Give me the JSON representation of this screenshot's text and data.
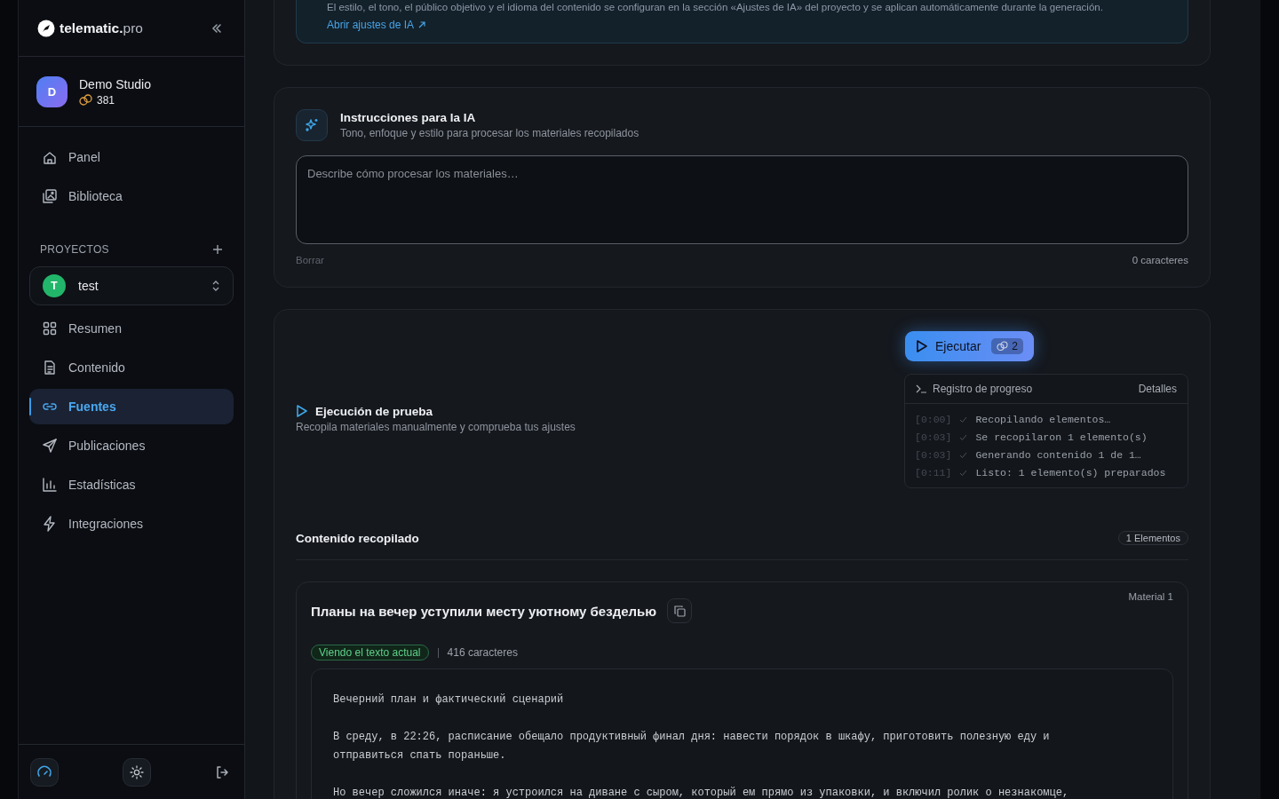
{
  "sidebar": {
    "brand": {
      "name": "telematic.",
      "suffix": "pro"
    },
    "account": {
      "initial": "D",
      "name": "Demo Studio",
      "credits": "381"
    },
    "nav": [
      {
        "label": "Panel",
        "selected": false
      },
      {
        "label": "Biblioteca",
        "selected": false
      }
    ],
    "projects_heading": "PROYECTOS",
    "project": {
      "initial": "T",
      "name": "test"
    },
    "project_nav": [
      {
        "label": "Resumen",
        "selected": false
      },
      {
        "label": "Contenido",
        "selected": false
      },
      {
        "label": "Fuentes",
        "selected": true
      },
      {
        "label": "Publicaciones",
        "selected": false
      },
      {
        "label": "Estadísticas",
        "selected": false
      },
      {
        "label": "Integraciones",
        "selected": false
      }
    ]
  },
  "ai_note": {
    "text": "El estilo, el tono, el público objetivo y el idioma del contenido se configuran en la sección «Ajustes de IA» del proyecto y se aplican automáticamente durante la generación.",
    "link": "Abrir ajustes de IA"
  },
  "instructions": {
    "title": "Instrucciones para la IA",
    "subtitle": "Tono, enfoque y estilo para procesar los materiales recopilados",
    "placeholder": "Describe cómo procesar los materiales…",
    "clear": "Borrar",
    "count": "0 caracteres"
  },
  "test_run": {
    "title": "Ejecución de prueba",
    "subtitle": "Recopila materiales manualmente y comprueba tus ajustes",
    "run_button": "Ejecutar",
    "run_cost": "2",
    "log": {
      "title": "Registro de progreso",
      "details": "Detalles",
      "entries": [
        {
          "time": "[0:00]",
          "message": "Recopilando elementos…"
        },
        {
          "time": "[0:03]",
          "message": "Se recopilaron 1 elemento(s)"
        },
        {
          "time": "[0:03]",
          "message": "Generando contenido 1 de 1…"
        },
        {
          "time": "[0:11]",
          "message": "Listo: 1 elemento(s) preparados"
        }
      ]
    }
  },
  "collected": {
    "title": "Contenido recopilado",
    "count": "1 Elementos",
    "items": [
      {
        "label": "Material 1",
        "title": "Планы на вечер уступили месту уютному безделью",
        "status": "Viendo el texto actual",
        "chars": "416 caracteres",
        "paragraphs": [
          "Вечерний план и фактический сценарий",
          "В среду, в 22:26, расписание обещало продуктивный финал дня: навести порядок в шкафу, приготовить полезную еду и отправиться спать пораньше.",
          "Но вечер сложился иначе: я устроился на диване с сыром, который ем прямо из упаковки, и включил ролик о незнакомце,"
        ]
      }
    ]
  }
}
